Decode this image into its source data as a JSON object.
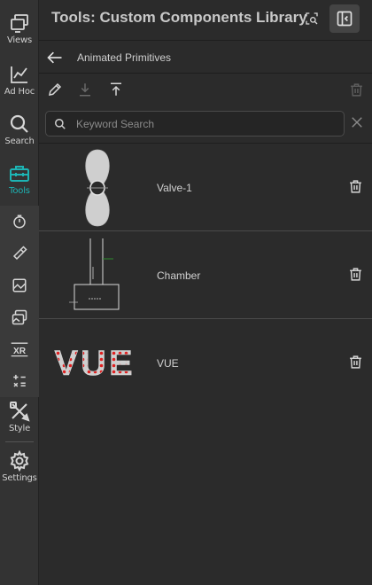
{
  "rail": {
    "items": [
      {
        "label": "Views",
        "icon": "views-icon"
      },
      {
        "label": "Ad Hoc",
        "icon": "chart-line-icon"
      },
      {
        "label": "Search",
        "icon": "search-icon"
      },
      {
        "label": "Tools",
        "icon": "toolbox-icon"
      },
      {
        "label": "Style",
        "icon": "style-tools-icon"
      },
      {
        "label": "Settings",
        "icon": "gear-icon"
      }
    ],
    "sub_items": [
      {
        "icon": "timer-icon"
      },
      {
        "icon": "paint-component-icon"
      },
      {
        "icon": "image-icon"
      },
      {
        "icon": "gallery-icon"
      },
      {
        "icon": "xr-icon",
        "text": "XR"
      },
      {
        "icon": "calculator-icon"
      }
    ],
    "accent": "#1db4b4"
  },
  "header": {
    "title": "Tools: Custom Components Library"
  },
  "breadcrumb": {
    "label": "Animated Primitives"
  },
  "toolbar": {
    "edit": "pencil-icon",
    "import": "download-icon",
    "export": "upload-icon",
    "delete": "trash-icon"
  },
  "search": {
    "placeholder": "Keyword Search",
    "value": ""
  },
  "components": [
    {
      "label": "Valve-1",
      "thumb": "valve-thumbnail"
    },
    {
      "label": "Chamber",
      "thumb": "chamber-thumbnail"
    },
    {
      "label": "VUE",
      "thumb": "vue-text-thumbnail",
      "thumb_text": "VUE"
    }
  ]
}
